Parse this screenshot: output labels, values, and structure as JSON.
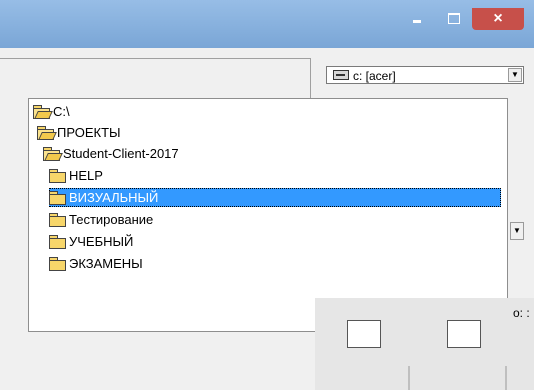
{
  "window": {
    "minimize_icon": "minimize-icon",
    "maximize_icon": "maximize-icon",
    "close_label": "×"
  },
  "drive_select": {
    "value": "c: [acer]",
    "icon": "drive-icon",
    "arrow": "▼"
  },
  "folder_tree": {
    "selected": "ВИЗУАЛЬНЫЙ",
    "items": [
      {
        "label": "C:\\",
        "icon": "open-folder-icon"
      },
      {
        "label": "ПРОЕКТЫ",
        "icon": "open-folder-icon"
      },
      {
        "label": "Student-Client-2017",
        "icon": "open-folder-icon"
      },
      {
        "label": "HELP",
        "icon": "folder-icon"
      },
      {
        "label": "ВИЗУАЛЬНЫЙ",
        "icon": "folder-icon"
      },
      {
        "label": "Тестирование",
        "icon": "folder-icon"
      },
      {
        "label": "УЧЕБНЫЙ",
        "icon": "folder-icon"
      },
      {
        "label": "ЭКЗАМЕНЫ",
        "icon": "folder-icon"
      }
    ]
  },
  "right_panel": {
    "spin_arrow": "▼",
    "o_label": "о: :"
  }
}
